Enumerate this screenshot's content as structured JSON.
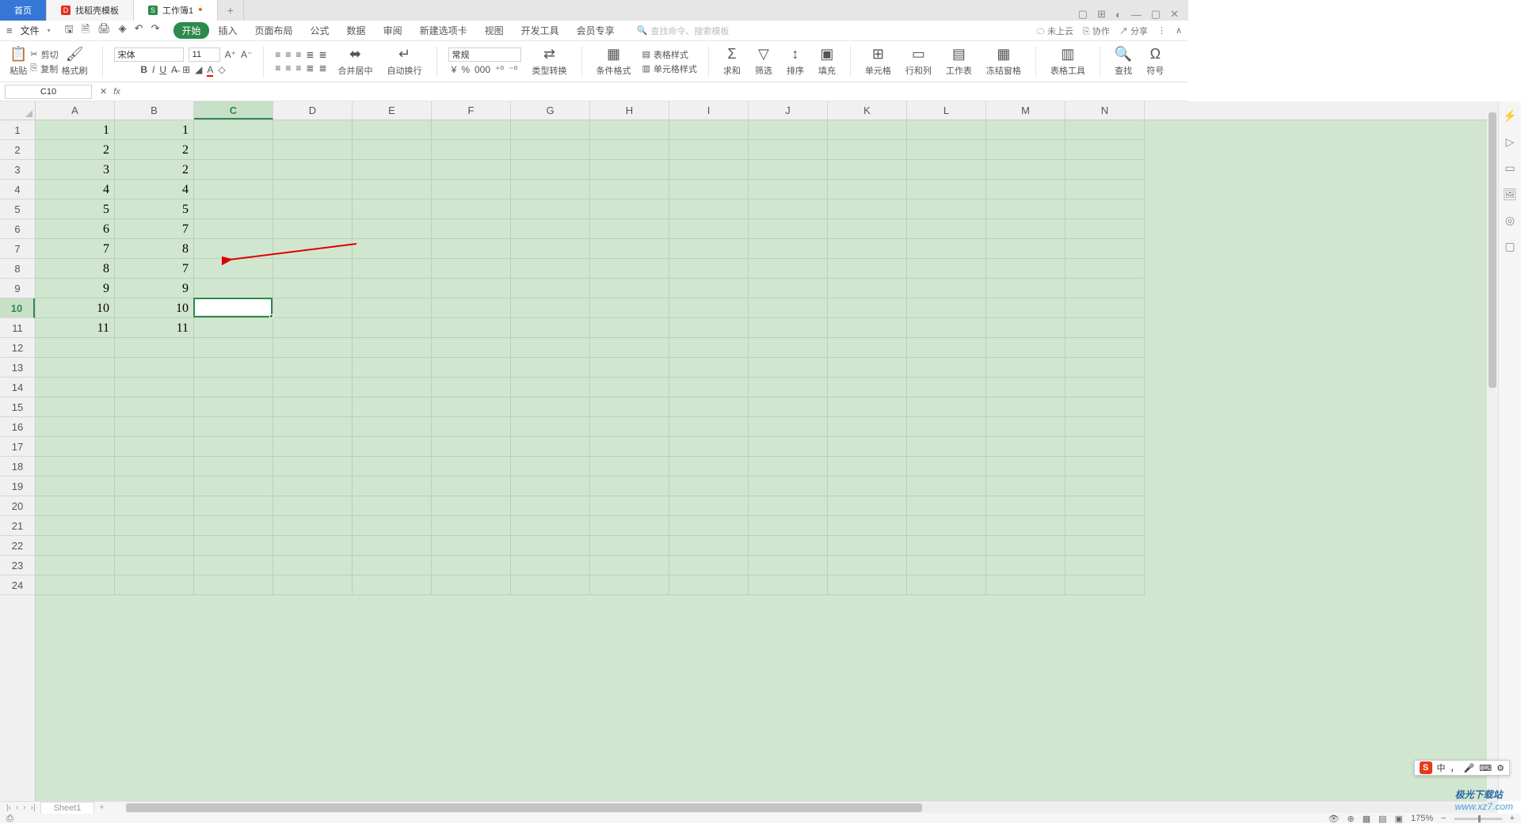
{
  "tabs": {
    "home": "首页",
    "doc1": "找稻壳模板",
    "doc2": "工作簿1"
  },
  "menu": {
    "file": "文件",
    "items": [
      "开始",
      "插入",
      "页面布局",
      "公式",
      "数据",
      "审阅",
      "新建选项卡",
      "视图",
      "开发工具",
      "会员专享"
    ],
    "search_placeholder": "查找命令、搜索模板",
    "right": {
      "cloud": "未上云",
      "collab": "协作",
      "share": "分享"
    }
  },
  "ribbon": {
    "paste": "粘贴",
    "cut": "剪切",
    "copy": "复制",
    "brush": "格式刷",
    "font": "宋体",
    "size": "11",
    "merge": "合并居中",
    "wrap": "自动换行",
    "format_general": "常规",
    "type_convert": "类型转换",
    "cond": "条件格式",
    "cellstyle": "单元格样式",
    "tablestyle": "表格样式",
    "sum": "求和",
    "filter": "筛选",
    "sort": "排序",
    "fill": "填充",
    "cell": "单元格",
    "rowcol": "行和列",
    "sheet": "工作表",
    "freeze": "冻结窗格",
    "tools": "表格工具",
    "find": "查找",
    "symbol": "符号"
  },
  "name_box": "C10",
  "columns": [
    "A",
    "B",
    "C",
    "D",
    "E",
    "F",
    "G",
    "H",
    "I",
    "J",
    "K",
    "L",
    "M",
    "N"
  ],
  "rows_count": 24,
  "active": {
    "col": 2,
    "row": 9
  },
  "data_a": [
    "1",
    "2",
    "3",
    "4",
    "5",
    "6",
    "7",
    "8",
    "9",
    "10",
    "11"
  ],
  "data_b": [
    "1",
    "2",
    "2",
    "4",
    "5",
    "7",
    "8",
    "7",
    "9",
    "10",
    "11"
  ],
  "sheet": "Sheet1",
  "zoom": "175%",
  "watermark_site": "www.xz7.com",
  "watermark_name": "极光下载站",
  "ime": {
    "lang": "中"
  }
}
